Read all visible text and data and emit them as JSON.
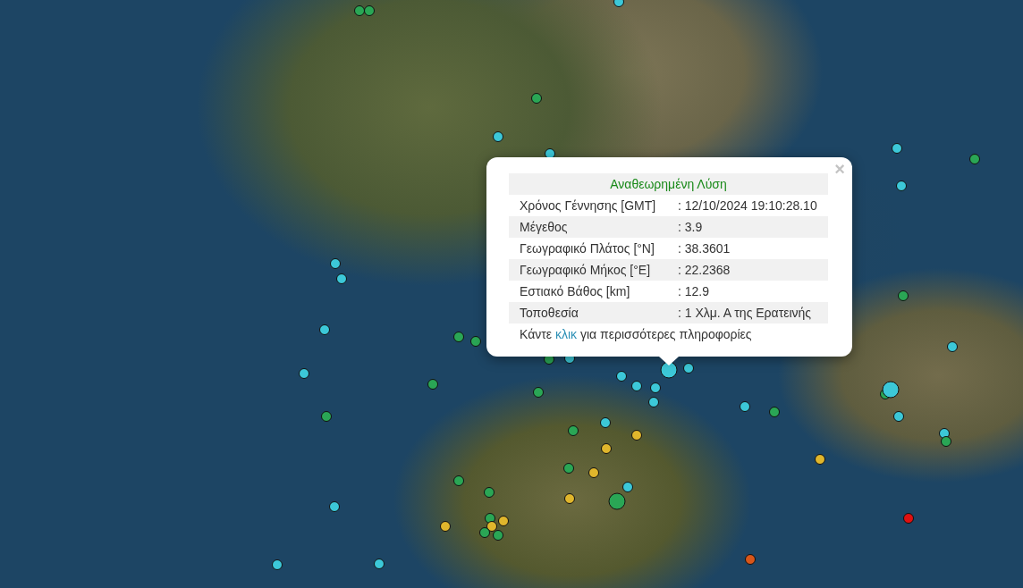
{
  "popup": {
    "close": "×",
    "title": "Αναθεωρημένη Λύση",
    "rows": [
      {
        "label": "Χρόνος Γέννησης [GMT]",
        "value": ": 12/10/2024 19:10:28.10"
      },
      {
        "label": "Μέγεθος",
        "value": ": 3.9"
      },
      {
        "label": "Γεωγραφικό Πλάτος [°N]",
        "value": ": 38.3601"
      },
      {
        "label": "Γεωγραφικό Μήκος [°E]",
        "value": ": 22.2368"
      },
      {
        "label": "Εστιακό Βάθος [km]",
        "value": ": 12.9"
      },
      {
        "label": "Τοποθεσία",
        "value": ": 1 Χλμ. Α της Ερατεινής"
      }
    ],
    "footer": {
      "before": "Κάντε",
      "link": "κλικ",
      "after": "για περισσότερες πληροφορίες"
    }
  }
}
